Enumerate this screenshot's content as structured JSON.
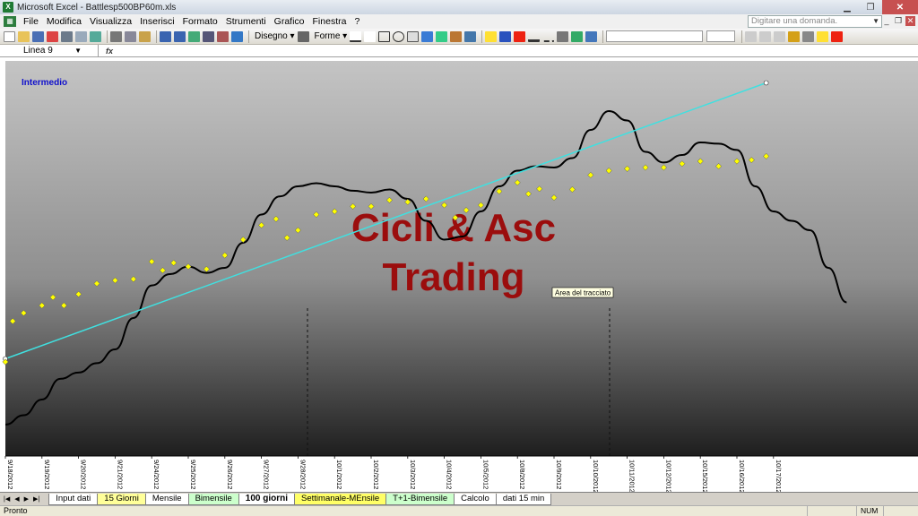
{
  "window": {
    "title": "Microsoft Excel - Battlesp500BP60m.xls",
    "app_icon": "excel-icon"
  },
  "menubar": {
    "items": [
      "File",
      "Modifica",
      "Visualizza",
      "Inserisci",
      "Formato",
      "Strumenti",
      "Grafico",
      "Finestra",
      "?"
    ],
    "ask_placeholder": "Digitare una domanda."
  },
  "toolbar": {
    "disegno_label": "Disegno ▾",
    "forme_label": "Forme ▾"
  },
  "formula_bar": {
    "name_box": "Linea 9",
    "fx_label": "fx"
  },
  "chart": {
    "label_intermedio": "Intermedio",
    "watermark_line1": "Cicli & Asc",
    "watermark_line2": "Trading",
    "tooltip": "Area del tracciato",
    "colors": {
      "price": "#ffff00",
      "cycle": "#000000",
      "trend": "#40e0e0",
      "watermark": "#9b0d0d",
      "label": "#1010cc"
    }
  },
  "chart_data": {
    "type": "line",
    "title": "",
    "xlabel": "",
    "ylabel": "",
    "x_tick_labels": [
      "9/18/2012",
      "9/19/2012",
      "9/20/2012",
      "9/21/2012",
      "9/24/2012",
      "9/25/2012",
      "9/26/2012",
      "9/27/2012",
      "9/28/2012",
      "10/1/2012",
      "10/2/2012",
      "10/3/2012",
      "10/4/2012",
      "10/5/2012",
      "10/8/2012",
      "10/9/2012",
      "10/10/2012",
      "10/11/2012",
      "10/12/2012",
      "10/15/2012",
      "10/16/2012",
      "10/17/2012"
    ],
    "grid": false,
    "legend": "none",
    "series": [
      {
        "style": "yellow diamond markers",
        "points": [
          [
            0,
            150
          ],
          [
            0.2,
            215
          ],
          [
            0.5,
            228
          ],
          [
            1,
            240
          ],
          [
            1.3,
            253
          ],
          [
            1.6,
            240
          ],
          [
            2,
            258
          ],
          [
            2.5,
            275
          ],
          [
            3,
            280
          ],
          [
            3.5,
            282
          ],
          [
            4,
            310
          ],
          [
            4.3,
            296
          ],
          [
            4.6,
            308
          ],
          [
            5,
            302
          ],
          [
            5.5,
            298
          ],
          [
            6,
            320
          ],
          [
            6.5,
            345
          ],
          [
            7,
            368
          ],
          [
            7.4,
            378
          ],
          [
            7.7,
            348
          ],
          [
            8,
            360
          ],
          [
            8.5,
            385
          ],
          [
            9,
            390
          ],
          [
            9.5,
            398
          ],
          [
            10,
            398
          ],
          [
            10.5,
            408
          ],
          [
            11,
            405
          ],
          [
            11.5,
            410
          ],
          [
            12,
            400
          ],
          [
            12.3,
            380
          ],
          [
            12.6,
            392
          ],
          [
            13,
            400
          ],
          [
            13.5,
            422
          ],
          [
            14,
            436
          ],
          [
            14.3,
            418
          ],
          [
            14.6,
            426
          ],
          [
            15,
            412
          ],
          [
            15.5,
            425
          ],
          [
            16,
            448
          ],
          [
            16.5,
            455
          ],
          [
            17,
            458
          ],
          [
            17.5,
            460
          ],
          [
            18,
            460
          ],
          [
            18.5,
            466
          ],
          [
            19,
            470
          ],
          [
            19.5,
            462
          ],
          [
            20,
            470
          ],
          [
            20.4,
            472
          ],
          [
            20.8,
            478
          ]
        ]
      },
      {
        "style": "black smooth line",
        "points": [
          [
            0,
            50
          ],
          [
            0.5,
            65
          ],
          [
            1,
            90
          ],
          [
            1.5,
            123
          ],
          [
            2,
            133
          ],
          [
            2.5,
            148
          ],
          [
            3,
            170
          ],
          [
            3.5,
            220
          ],
          [
            4,
            272
          ],
          [
            4.5,
            290
          ],
          [
            5,
            302
          ],
          [
            5.5,
            292
          ],
          [
            6,
            300
          ],
          [
            6.5,
            340
          ],
          [
            7,
            385
          ],
          [
            7.5,
            414
          ],
          [
            8,
            430
          ],
          [
            8.5,
            435
          ],
          [
            9,
            430
          ],
          [
            9.5,
            423
          ],
          [
            10,
            420
          ],
          [
            10.5,
            425
          ],
          [
            11,
            410
          ],
          [
            11.5,
            375
          ],
          [
            12,
            345
          ],
          [
            12.5,
            350
          ],
          [
            13,
            390
          ],
          [
            13.5,
            430
          ],
          [
            14,
            455
          ],
          [
            14.5,
            462
          ],
          [
            15,
            460
          ],
          [
            15.5,
            475
          ],
          [
            16,
            520
          ],
          [
            16.5,
            550
          ],
          [
            17,
            535
          ],
          [
            17.5,
            485
          ],
          [
            18,
            468
          ],
          [
            18.5,
            480
          ],
          [
            19,
            500
          ],
          [
            19.5,
            498
          ],
          [
            20,
            488
          ],
          [
            20.5,
            430
          ],
          [
            21,
            390
          ],
          [
            21.5,
            375
          ],
          [
            22,
            360
          ],
          [
            22.5,
            300
          ],
          [
            23,
            245
          ]
        ]
      },
      {
        "style": "cyan straight line",
        "points": [
          [
            0,
            155
          ],
          [
            20.8,
            595
          ]
        ]
      }
    ]
  },
  "sheet_tabs": [
    {
      "label": "Input dati",
      "color": "#ffffff"
    },
    {
      "label": "15 Giorni",
      "color": "#ffff99"
    },
    {
      "label": "Mensile",
      "color": "#ffffff"
    },
    {
      "label": "Bimensile",
      "color": "#ccffcc"
    },
    {
      "label": "100 giorni",
      "color": "#ffffff",
      "active": true
    },
    {
      "label": "Settimanale-MEnsile",
      "color": "#ffff66"
    },
    {
      "label": "T+1-Bimensile",
      "color": "#ccffcc"
    },
    {
      "label": "Calcolo",
      "color": "#ffffff"
    },
    {
      "label": "dati 15 min",
      "color": "#ffffff"
    }
  ],
  "status": {
    "left": "Pronto",
    "num": "NUM"
  }
}
